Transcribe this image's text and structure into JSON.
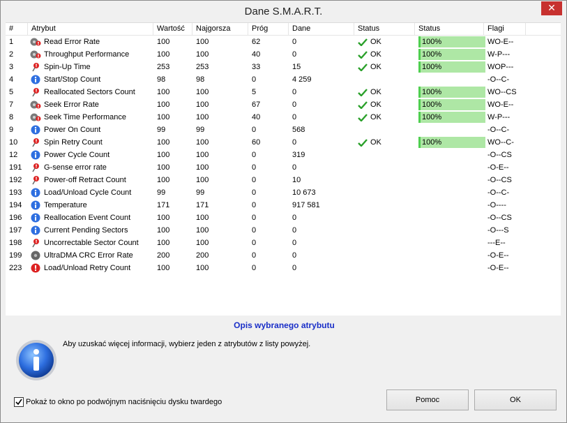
{
  "window": {
    "title": "Dane S.M.A.R.T.",
    "close_glyph": "✕"
  },
  "columns": [
    "#",
    "Atrybut",
    "Wartość",
    "Najgorsza",
    "Próg",
    "Dane",
    "Status",
    "Status",
    "Flagi"
  ],
  "ok_label": "OK",
  "rows": [
    {
      "id": "1",
      "name": "Read Error Rate",
      "icon": "disk-error-icon",
      "value": "100",
      "worst": "100",
      "threshold": "62",
      "data": "0",
      "status": "OK",
      "percent": "100%",
      "flags": "WO-E--"
    },
    {
      "id": "2",
      "name": "Throughput Performance",
      "icon": "disk-error-icon",
      "value": "100",
      "worst": "100",
      "threshold": "40",
      "data": "0",
      "status": "OK",
      "percent": "100%",
      "flags": "W-P---"
    },
    {
      "id": "3",
      "name": "Spin-Up Time",
      "icon": "pin-warning-icon",
      "value": "253",
      "worst": "253",
      "threshold": "33",
      "data": "15",
      "status": "OK",
      "percent": "100%",
      "flags": "WOP---"
    },
    {
      "id": "4",
      "name": "Start/Stop Count",
      "icon": "info-icon",
      "value": "98",
      "worst": "98",
      "threshold": "0",
      "data": "4 259",
      "status": "",
      "percent": "",
      "flags": "-O--C-"
    },
    {
      "id": "5",
      "name": "Reallocated Sectors Count",
      "icon": "pin-warning-icon",
      "value": "100",
      "worst": "100",
      "threshold": "5",
      "data": "0",
      "status": "OK",
      "percent": "100%",
      "flags": "WO--CS"
    },
    {
      "id": "7",
      "name": "Seek Error Rate",
      "icon": "disk-error-icon",
      "value": "100",
      "worst": "100",
      "threshold": "67",
      "data": "0",
      "status": "OK",
      "percent": "100%",
      "flags": "WO-E--"
    },
    {
      "id": "8",
      "name": "Seek Time Performance",
      "icon": "disk-error-icon",
      "value": "100",
      "worst": "100",
      "threshold": "40",
      "data": "0",
      "status": "OK",
      "percent": "100%",
      "flags": "W-P---"
    },
    {
      "id": "9",
      "name": "Power On Count",
      "icon": "info-icon",
      "value": "99",
      "worst": "99",
      "threshold": "0",
      "data": "568",
      "status": "",
      "percent": "",
      "flags": "-O--C-"
    },
    {
      "id": "10",
      "name": "Spin Retry Count",
      "icon": "pin-warning-icon",
      "value": "100",
      "worst": "100",
      "threshold": "60",
      "data": "0",
      "status": "OK",
      "percent": "100%",
      "flags": "WO--C-"
    },
    {
      "id": "12",
      "name": "Power Cycle Count",
      "icon": "info-icon",
      "value": "100",
      "worst": "100",
      "threshold": "0",
      "data": "319",
      "status": "",
      "percent": "",
      "flags": "-O--CS"
    },
    {
      "id": "191",
      "name": "G-sense error rate",
      "icon": "pin-warning-icon",
      "value": "100",
      "worst": "100",
      "threshold": "0",
      "data": "0",
      "status": "",
      "percent": "",
      "flags": "-O-E--"
    },
    {
      "id": "192",
      "name": "Power-off Retract Count",
      "icon": "pin-warning-icon",
      "value": "100",
      "worst": "100",
      "threshold": "0",
      "data": "10",
      "status": "",
      "percent": "",
      "flags": "-O--CS"
    },
    {
      "id": "193",
      "name": "Load/Unload Cycle Count",
      "icon": "info-icon",
      "value": "99",
      "worst": "99",
      "threshold": "0",
      "data": "10 673",
      "status": "",
      "percent": "",
      "flags": "-O--C-"
    },
    {
      "id": "194",
      "name": "Temperature",
      "icon": "info-icon",
      "value": "171",
      "worst": "171",
      "threshold": "0",
      "data": "917 581",
      "status": "",
      "percent": "",
      "flags": "-O----"
    },
    {
      "id": "196",
      "name": "Reallocation Event Count",
      "icon": "info-icon",
      "value": "100",
      "worst": "100",
      "threshold": "0",
      "data": "0",
      "status": "",
      "percent": "",
      "flags": "-O--CS"
    },
    {
      "id": "197",
      "name": "Current Pending Sectors",
      "icon": "info-icon",
      "value": "100",
      "worst": "100",
      "threshold": "0",
      "data": "0",
      "status": "",
      "percent": "",
      "flags": "-O---S"
    },
    {
      "id": "198",
      "name": "Uncorrectable Sector Count",
      "icon": "pin-warning-icon",
      "value": "100",
      "worst": "100",
      "threshold": "0",
      "data": "0",
      "status": "",
      "percent": "",
      "flags": "---E--"
    },
    {
      "id": "199",
      "name": "UltraDMA CRC Error Rate",
      "icon": "disk-icon",
      "value": "200",
      "worst": "200",
      "threshold": "0",
      "data": "0",
      "status": "",
      "percent": "",
      "flags": "-O-E--"
    },
    {
      "id": "223",
      "name": "Load/Unload Retry Count",
      "icon": "error-icon",
      "value": "100",
      "worst": "100",
      "threshold": "0",
      "data": "0",
      "status": "",
      "percent": "",
      "flags": "-O-E--"
    }
  ],
  "description": {
    "title": "Opis wybranego atrybutu",
    "text": "Aby uzuskać więcej informacji, wybierz jeden z atrybutów z listy powyżej.",
    "icon": "info-large-icon"
  },
  "footer": {
    "checkbox_label": "Pokaż to okno po podwójnym naciśnięciu dysku twardego",
    "checkbox_checked": true,
    "help_label": "Pomoc",
    "ok_label": "OK"
  },
  "colors": {
    "bar_fill": "#aee7a5",
    "bar_edge": "#4fcf4f",
    "desc_title": "#1a2fc8",
    "close_bg": "#c7312f"
  }
}
